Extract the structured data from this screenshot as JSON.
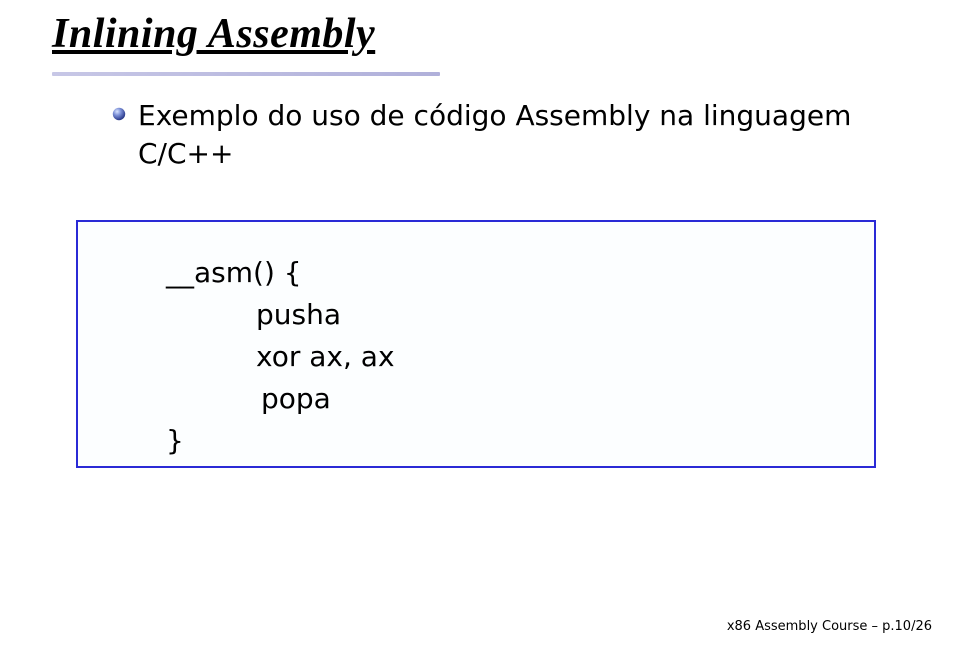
{
  "title": "Inlining Assembly",
  "bullet": "Exemplo do uso de código Assembly na linguagem C/C++",
  "code": {
    "l1": "__asm() {",
    "l2": "pusha",
    "l3": "xor ax, ax",
    "l4": "popa",
    "l5": "}"
  },
  "footer": "x86 Assembly Course – p.10/26"
}
